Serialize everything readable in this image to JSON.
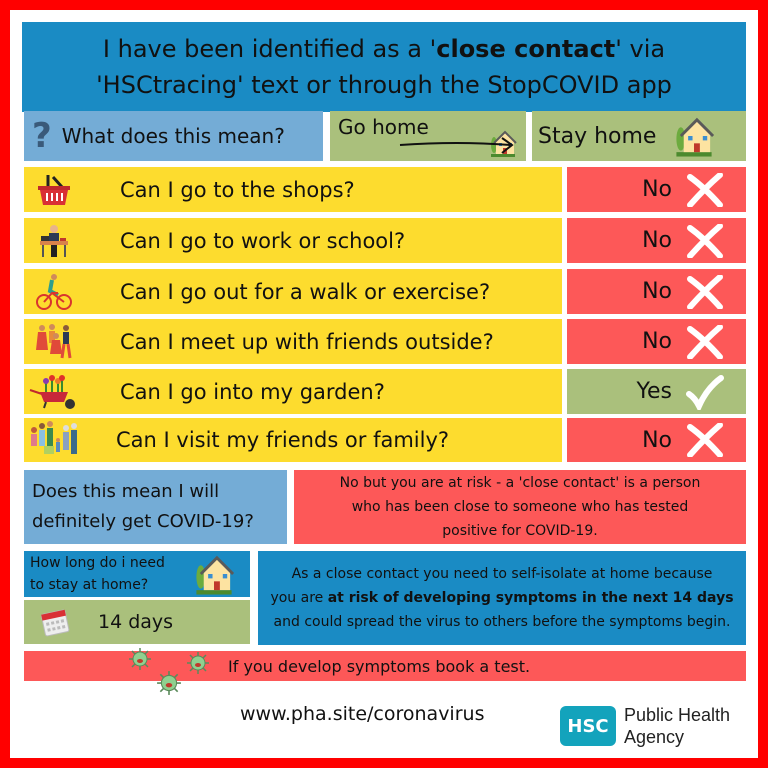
{
  "header": {
    "line1_pre": "I have been identified as a '",
    "line1_bold": "close contact",
    "line1_post": "' via",
    "line2": "'HSCtracing' text or through the StopCOVID app"
  },
  "top_row": {
    "meaning_icon": "question-mark-icon",
    "meaning_label": "What does this mean?",
    "go_home_label": "Go home",
    "go_home_icon": "house-icon",
    "stay_home_label": "Stay home",
    "stay_home_icon": "house-icon"
  },
  "questions": [
    {
      "icon": "shopping-basket-icon",
      "text": "Can I go to the shops?",
      "answer": "No",
      "answer_icon": "cross-icon",
      "allowed": false
    },
    {
      "icon": "office-worker-icon",
      "text": "Can I go to work or school?",
      "answer": "No",
      "answer_icon": "cross-icon",
      "allowed": false
    },
    {
      "icon": "cyclist-icon",
      "text": "Can I go out for a walk or exercise?",
      "answer": "No",
      "answer_icon": "cross-icon",
      "allowed": false
    },
    {
      "icon": "friends-group-icon",
      "text": "Can I meet up with friends outside?",
      "answer": "No",
      "answer_icon": "cross-icon",
      "allowed": false
    },
    {
      "icon": "wheelbarrow-flowers-icon",
      "text": "Can I go into my garden?",
      "answer": "Yes",
      "answer_icon": "check-icon",
      "allowed": true
    },
    {
      "icon": "family-icon",
      "text": "Can I visit my friends or family?",
      "answer": "No",
      "answer_icon": "cross-icon",
      "allowed": false
    }
  ],
  "definitely": {
    "question_line1": "Does this mean I will",
    "question_line2": "definitely get COVID-19?",
    "answer_line1": "No but you are at risk - a 'close contact' is a person",
    "answer_line2": "who has been close to someone who has tested",
    "answer_line3": "positive for COVID-19."
  },
  "how_long": {
    "question_line1": "How long do i need",
    "question_line2": "to stay at home?",
    "question_icon": "house-icon",
    "answer_icon": "calendar-icon",
    "answer": "14 days"
  },
  "isolate": {
    "line1": "As a close contact you need to self-isolate at home because",
    "line2_pre": "you are ",
    "line2_bold": "at risk of developing symptoms in the next 14 days",
    "line3": "and could spread the virus to others before the symptoms begin."
  },
  "symptoms": {
    "icon": "virus-icon",
    "text": "If you develop symptoms book a test."
  },
  "footer": {
    "url": "www.pha.site/coronavirus",
    "logo_badge": "HSC",
    "logo_line1": "Public Health",
    "logo_line2": "Agency"
  },
  "colors": {
    "frame_red": "#ff0000",
    "header_blue": "#1a8bc4",
    "light_blue": "#74acd6",
    "green": "#aac07c",
    "yellow": "#fddc2e",
    "red": "#fd5858",
    "hsc_teal": "#13a3bc"
  }
}
